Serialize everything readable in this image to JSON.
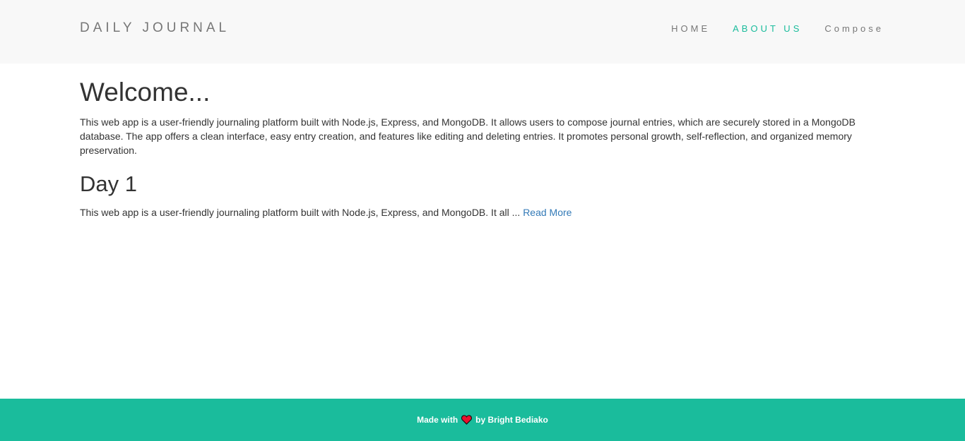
{
  "navbar": {
    "brand": "DAILY JOURNAL",
    "items": [
      {
        "label": "HOME",
        "active": false
      },
      {
        "label": "ABOUT US",
        "active": true
      },
      {
        "label": "Compose",
        "active": false
      }
    ]
  },
  "main": {
    "title": "Welcome...",
    "intro": "This web app is a user-friendly journaling platform built with Node.js, Express, and MongoDB. It allows users to compose journal entries, which are securely stored in a MongoDB database. The app offers a clean interface, easy entry creation, and features like editing and deleting entries. It promotes personal growth, self-reflection, and organized memory preservation.",
    "posts": [
      {
        "title": "Day 1",
        "excerpt": "This web app is a user-friendly journaling platform built with Node.js, Express, and MongoDB. It all ...",
        "read_more": "Read More"
      }
    ]
  },
  "footer": {
    "prefix": "Made with",
    "icon": "heart-icon",
    "suffix": "by Bright Bediako"
  },
  "colors": {
    "accent": "#1abc9c",
    "navbar_bg": "#f8f8f8",
    "link": "#337ab7",
    "heart": "#e8112d"
  }
}
